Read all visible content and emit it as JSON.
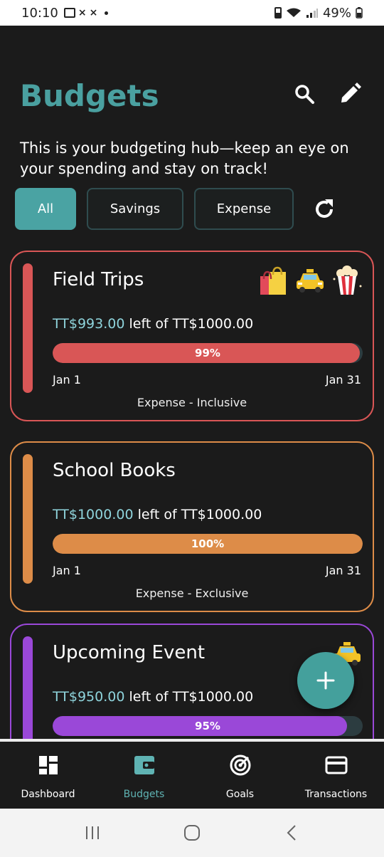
{
  "status_bar": {
    "time": "10:10",
    "battery": "49%"
  },
  "header": {
    "title": "Budgets",
    "subtitle": "This is your budgeting hub—keep an eye on your spending and stay on track!",
    "search_icon": "search-icon",
    "edit_icon": "pencil-icon"
  },
  "filters": {
    "chips": [
      {
        "label": "All",
        "active": true
      },
      {
        "label": "Savings",
        "active": false
      },
      {
        "label": "Expense",
        "active": false
      }
    ],
    "refresh_icon": "refresh-icon"
  },
  "budgets": [
    {
      "name": "Field Trips",
      "amount_left": "TT$993.00",
      "left_of_text": "left of TT$1000.00",
      "progress_label": "99%",
      "progress": 0.99,
      "start": "Jan 1",
      "end": "Jan 31",
      "type": "Expense - Inclusive",
      "color": "#d95656",
      "icons": [
        "shopping-bags-icon",
        "taxi-icon",
        "popcorn-icon"
      ]
    },
    {
      "name": "School Books",
      "amount_left": "TT$1000.00",
      "left_of_text": "left of TT$1000.00",
      "progress_label": "100%",
      "progress": 1.0,
      "start": "Jan 1",
      "end": "Jan 31",
      "type": "Expense - Exclusive",
      "color": "#dd8c48",
      "icons": []
    },
    {
      "name": "Upcoming Event",
      "amount_left": "TT$950.00",
      "left_of_text": "left of TT$1000.00",
      "progress_label": "95%",
      "progress": 0.95,
      "start": "",
      "end": "",
      "type": "",
      "color": "#9a48d8",
      "icons": [
        "taxi-icon"
      ]
    }
  ],
  "fab": {
    "icon": "plus-icon"
  },
  "bottom_nav": [
    {
      "label": "Dashboard",
      "icon": "dashboard-icon",
      "active": false
    },
    {
      "label": "Budgets",
      "icon": "wallet-icon",
      "active": true
    },
    {
      "label": "Goals",
      "icon": "goals-icon",
      "active": false
    },
    {
      "label": "Transactions",
      "icon": "card-icon",
      "active": false
    }
  ],
  "colors": {
    "accent": "#4aa3a3",
    "background": "#1b1b1b",
    "amount": "#8fd4dc"
  }
}
